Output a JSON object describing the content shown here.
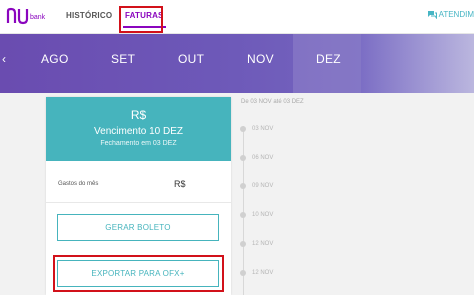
{
  "header": {
    "logo_word": "bank",
    "tabs": [
      {
        "label": "HISTÓRICO"
      },
      {
        "label": "FATURAS"
      }
    ],
    "attend_label": "ATENDIM"
  },
  "months": {
    "items": [
      "AGO",
      "SET",
      "OUT",
      "NOV",
      "DEZ"
    ],
    "selected": "DEZ"
  },
  "bill": {
    "amount": "R$",
    "due": "Vencimento 10 DEZ",
    "closing": "Fechamento em 03 DEZ",
    "spend_label": "Gastos do mês",
    "spend_value": "R$",
    "boleto_button": "GERAR BOLETO",
    "ofx_button": "EXPORTAR PARA OFX+"
  },
  "timeline": {
    "range": "De 03 NOV até 03 DEZ",
    "entries": [
      "03 NOV",
      "06 NOV",
      "09 NOV",
      "10 NOV",
      "12 NOV",
      "12 NOV"
    ]
  },
  "colors": {
    "brand_purple": "#8a05be",
    "teal": "#46b4bd",
    "highlight_red": "#d2111a"
  }
}
